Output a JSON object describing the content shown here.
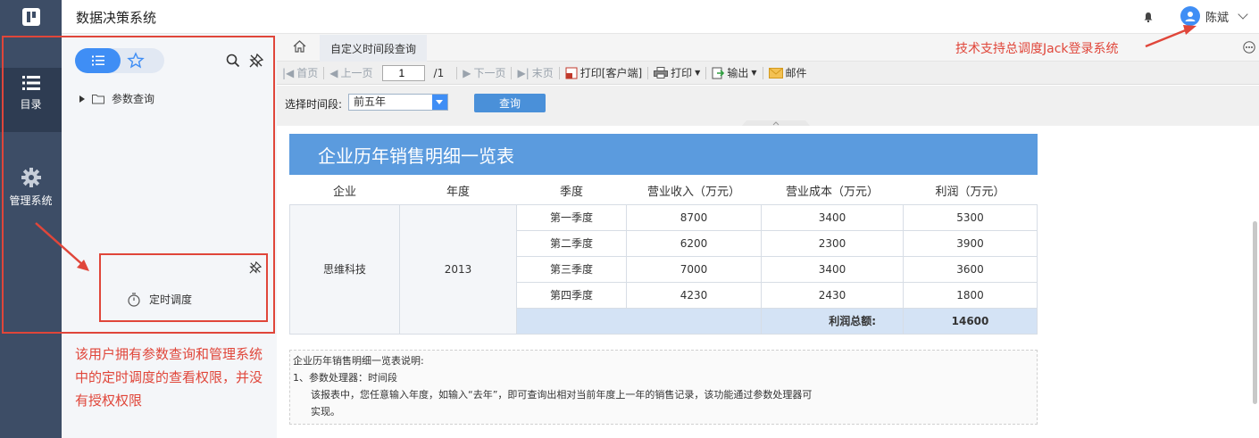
{
  "app": {
    "title": "数据决策系统"
  },
  "user": {
    "name": "陈斌"
  },
  "rail": {
    "items": [
      {
        "label": "目录"
      },
      {
        "label": "管理系统"
      }
    ]
  },
  "directory": {
    "tree": [
      {
        "label": "参数查询"
      }
    ],
    "schedule": {
      "label": "定时调度"
    }
  },
  "annotations": {
    "left_note": "该用户拥有参数查询和管理系统中的定时调度的查看权限，并没有授权权限",
    "right_note": "技术支持总调度Jack登录系统"
  },
  "tabs": [
    {
      "label": "自定义时间段查询"
    }
  ],
  "toolbar": {
    "first": "首页",
    "prev": "上一页",
    "page_value": "1",
    "page_total": "/1",
    "next": "下一页",
    "last": "末页",
    "print_client": "打印[客户端]",
    "print": "打印",
    "export": "输出",
    "mail": "邮件"
  },
  "params": {
    "label": "选择时间段:",
    "value": "前五年",
    "query_button": "查询"
  },
  "report": {
    "title": "企业历年销售明细一览表",
    "headers": [
      "企业",
      "年度",
      "季度",
      "营业收入（万元）",
      "营业成本（万元）",
      "利润（万元）"
    ],
    "company": "思维科技",
    "year": "2013",
    "rows": [
      {
        "quarter": "第一季度",
        "revenue": "8700",
        "cost": "3400",
        "profit": "5300"
      },
      {
        "quarter": "第二季度",
        "revenue": "6200",
        "cost": "2300",
        "profit": "3900"
      },
      {
        "quarter": "第三季度",
        "revenue": "7000",
        "cost": "3400",
        "profit": "3600"
      },
      {
        "quarter": "第四季度",
        "revenue": "4230",
        "cost": "2430",
        "profit": "1800"
      }
    ],
    "total_label": "利润总额:",
    "total_value": "14600",
    "description": {
      "title": "企业历年销售明细一览表说明:",
      "item1": "1、参数处理器：时间段",
      "item1_text_line1": "该报表中，您任意输入年度，如输入“去年”，即可查询出相对当前年度上一年的销售记录，该功能通过参数处理器可",
      "item1_text_line2": "实现。"
    }
  },
  "colors": {
    "rail": "#3d4d66",
    "accent": "#3f8ef5",
    "annotation": "#e0463a",
    "title_bar": "#5b9bde"
  }
}
